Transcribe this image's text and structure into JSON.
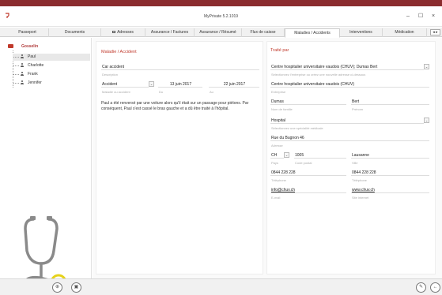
{
  "window": {
    "title": "MyPrivate 5.2.1019",
    "minimize": "–",
    "maximize": "☐",
    "close": "×"
  },
  "tabs": [
    {
      "label": "Passeport"
    },
    {
      "label": "Documents"
    },
    {
      "label": "Adresses"
    },
    {
      "label": "Assurance / Factures"
    },
    {
      "label": "Assurance / Résumé"
    },
    {
      "label": "Flux de caisse"
    },
    {
      "label": "Maladies / Accidents"
    },
    {
      "label": "Interventions"
    },
    {
      "label": "Médication"
    }
  ],
  "tab_scroll": "◂ ▸",
  "tree": {
    "root": "Gosselin",
    "members": [
      "Paul",
      "Charlotte",
      "Frank",
      "Jennifer"
    ]
  },
  "maladie": {
    "title": "Maladie / Accident",
    "description": "Car accident",
    "description_label": "Description",
    "type": "Accident",
    "type_label": "Maladie ou accident",
    "date_from": "13 juin 2017",
    "date_from_label": "Du",
    "date_to": "22 juin 2017",
    "date_to_label": "Au",
    "notes": "Paul a été renversé par une voiture alors qu'il était sur un passage pour piétons. Par conséquent, Paul s'est cassé le bras gauche et a dû être traité à l'hôpital."
  },
  "traite": {
    "title": "Traité par",
    "medecin": "Centre hospitalier universitaire vaudois (CHUV); Dumas Bert",
    "medecin_label": "Sélectionnez l'entreprise ou créez une nouvelle adresse ci-dessous",
    "entreprise": "Centre hospitalier universitaire vaudois (CHUV)",
    "entreprise_label": "Entreprise",
    "nom": "Dumas",
    "nom_label": "Nom de famille",
    "prenom": "Bert",
    "prenom_label": "Prénom",
    "specialite": "Hospital",
    "specialite_label": "Sélectionnez une spécialité médicale",
    "adresse": "Rue du Bugnon 46",
    "adresse_label": "Adresse",
    "pays": "CH",
    "pays_label": "Pays",
    "npa": "1005",
    "npa_label": "Code postal",
    "ville": "Lausanne",
    "ville_label": "Ville",
    "telephone": "0844 228 228",
    "telephone_label": "Téléphone",
    "telephone2": "0844 228 228",
    "telephone2_label": "Téléphone",
    "email": "info@chuv.ch",
    "email_label": "E-mail",
    "site": "www.chuv.ch",
    "site_label": "Site internet"
  },
  "colors": {
    "accent": "#c0392b",
    "stripe": "#8b2c2f",
    "ring": "#e6d21a"
  },
  "footer": {
    "add_icon": "add-icon",
    "delete_icon": "delete-icon",
    "edit_icon": "edit-icon",
    "back_icon": "back-icon"
  }
}
